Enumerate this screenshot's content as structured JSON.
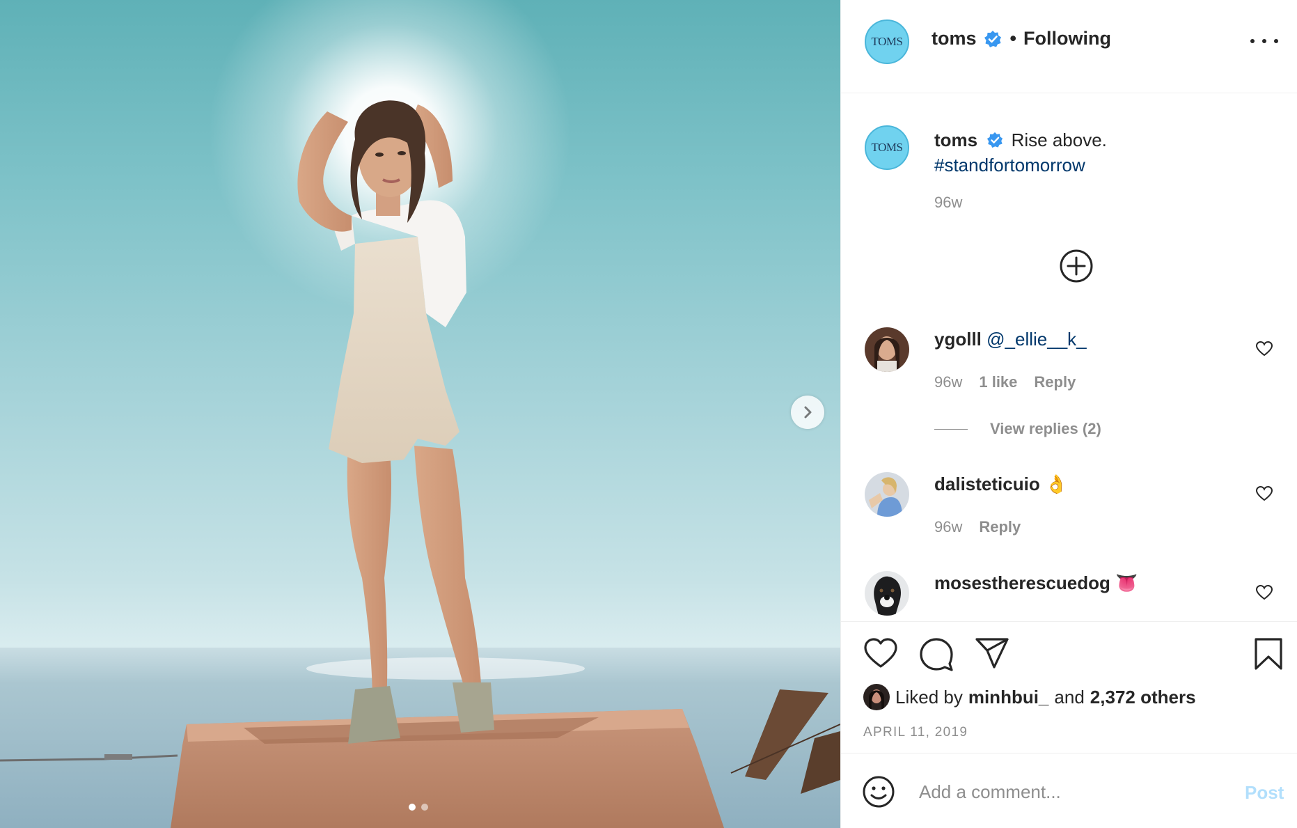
{
  "post": {
    "image_alt": "Model in crochet romper standing on a concrete block under a bright sun",
    "carousel": {
      "slides": 2,
      "current": 1
    },
    "next_icon": "chevron-right-icon"
  },
  "header": {
    "avatar_text": "TOMS",
    "username": "toms",
    "separator": "•",
    "follow_status": "Following",
    "more_icon": "more-horizontal-icon"
  },
  "caption": {
    "avatar_text": "TOMS",
    "username": "toms",
    "text": "Rise above.",
    "hashtag": "#standfortomorrow",
    "time": "96w"
  },
  "comments": [
    {
      "username": "ygolll",
      "mention": "@_ellie__k_",
      "time": "96w",
      "likes": "1 like",
      "reply": "Reply",
      "view_replies": "View replies (2)"
    },
    {
      "username": "dalisteticuio",
      "emoji": "👌",
      "time": "96w",
      "reply": "Reply"
    },
    {
      "username": "mosestherescuedog",
      "emoji": "👅"
    }
  ],
  "actions": {
    "liked_by_prefix": "Liked by",
    "liked_by_user": "minhbui_",
    "and": "and",
    "others": "2,372 others",
    "date": "APRIL 11, 2019"
  },
  "comment_box": {
    "placeholder": "Add a comment...",
    "post_label": "Post"
  },
  "colors": {
    "brand_avatar": "#70d2ef",
    "verified": "#3897f0",
    "link": "#00376b",
    "muted": "#8e8e8e",
    "post_disabled": "#b2dffc"
  }
}
